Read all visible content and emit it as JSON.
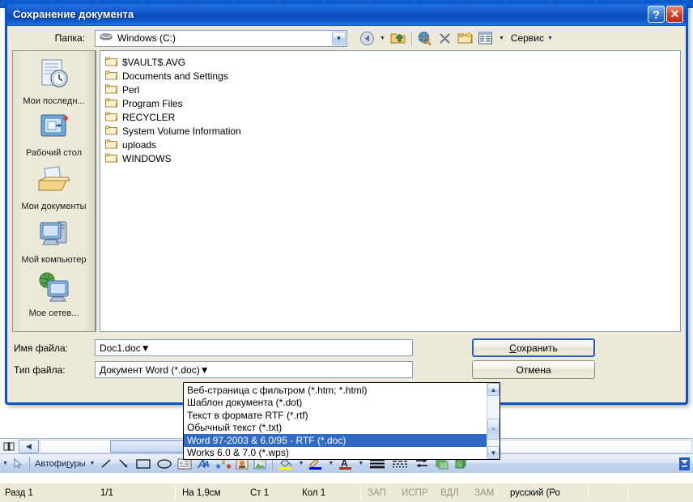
{
  "dialog": {
    "title": "Сохранение документа",
    "titlebar_buttons": [
      {
        "name": "help",
        "glyph": "?"
      },
      {
        "name": "close",
        "glyph": "✕"
      }
    ],
    "lookin": {
      "label": "Папка:",
      "value": "Windows (C:)",
      "icon": "hard-drive-icon"
    },
    "toolbar": {
      "items": [
        {
          "name": "back-icon",
          "title": "Назад"
        },
        {
          "name": "up-one-level-icon",
          "title": "Вверх"
        },
        {
          "name": "search-web-icon",
          "title": "Поиск в Интернете"
        },
        {
          "name": "delete-icon",
          "title": "Удалить"
        },
        {
          "name": "new-folder-icon",
          "title": "Создать папку"
        },
        {
          "name": "views-icon",
          "title": "Представления"
        }
      ],
      "tools_label": "Сервис"
    },
    "places": [
      {
        "label": "Мои последн...",
        "icon": "recent-documents-icon"
      },
      {
        "label": "Рабочий стол",
        "icon": "desktop-icon"
      },
      {
        "label": "Мои документы",
        "icon": "my-documents-icon"
      },
      {
        "label": "Мой компьютер",
        "icon": "my-computer-icon"
      },
      {
        "label": "Мое сетев...",
        "icon": "network-places-icon"
      }
    ],
    "files": [
      {
        "name": "$VAULT$.AVG",
        "type": "folder"
      },
      {
        "name": "Documents and Settings",
        "type": "folder"
      },
      {
        "name": "Perl",
        "type": "folder"
      },
      {
        "name": "Program Files",
        "type": "folder"
      },
      {
        "name": "RECYCLER",
        "type": "folder"
      },
      {
        "name": "System Volume Information",
        "type": "folder"
      },
      {
        "name": "uploads",
        "type": "folder"
      },
      {
        "name": "WINDOWS",
        "type": "folder"
      }
    ],
    "filename": {
      "label": "Имя файла:",
      "value": "Doc1.doc"
    },
    "filetype": {
      "label": "Тип файла:",
      "value": "Документ Word (*.doc)",
      "options": [
        "Веб-страница с фильтром (*.htm; *.html)",
        "Шаблон документа (*.dot)",
        "Текст в формате RTF (*.rtf)",
        "Обычный текст (*.txt)",
        "Word 97-2003 & 6.0/95 - RTF (*.doc)",
        "Works 6.0 & 7.0 (*.wps)"
      ],
      "selected_option": "Word 97-2003 & 6.0/95 - RTF (*.doc)"
    },
    "buttons": {
      "save": "Сохранить",
      "save_accel": "С",
      "cancel": "Отмена"
    }
  },
  "drawing_toolbar": {
    "autoshapes_label": "Автофигуры",
    "autoshapes_accel": "г",
    "items": [
      {
        "name": "select-objects-icon"
      },
      {
        "name": "line-icon"
      },
      {
        "name": "arrow-icon"
      },
      {
        "name": "rectangle-icon"
      },
      {
        "name": "oval-icon"
      },
      {
        "name": "text-box-icon"
      },
      {
        "name": "wordart-icon"
      },
      {
        "name": "diagram-icon"
      },
      {
        "name": "clip-art-icon"
      },
      {
        "name": "picture-icon"
      },
      {
        "name": "fill-color-icon"
      },
      {
        "name": "line-color-icon"
      },
      {
        "name": "font-color-icon"
      },
      {
        "name": "line-style-icon"
      },
      {
        "name": "dash-style-icon"
      },
      {
        "name": "arrow-style-icon"
      },
      {
        "name": "shadow-style-icon"
      },
      {
        "name": "three-d-style-icon"
      }
    ]
  },
  "statusbar": {
    "section": "Разд 1",
    "page": "1/1",
    "at": "На 1,9см",
    "line": "Ст 1",
    "col": "Кол 1",
    "rec": "ЗАП",
    "trk": "ИСПР",
    "ext": "ВДЛ",
    "ovr": "ЗАМ",
    "language": "русский (Ро"
  },
  "colors": {
    "titlebar_blue": "#0b53c8",
    "dialog_face": "#ece9d8",
    "selection_blue": "#316ac5",
    "close_red": "#d9452b"
  }
}
